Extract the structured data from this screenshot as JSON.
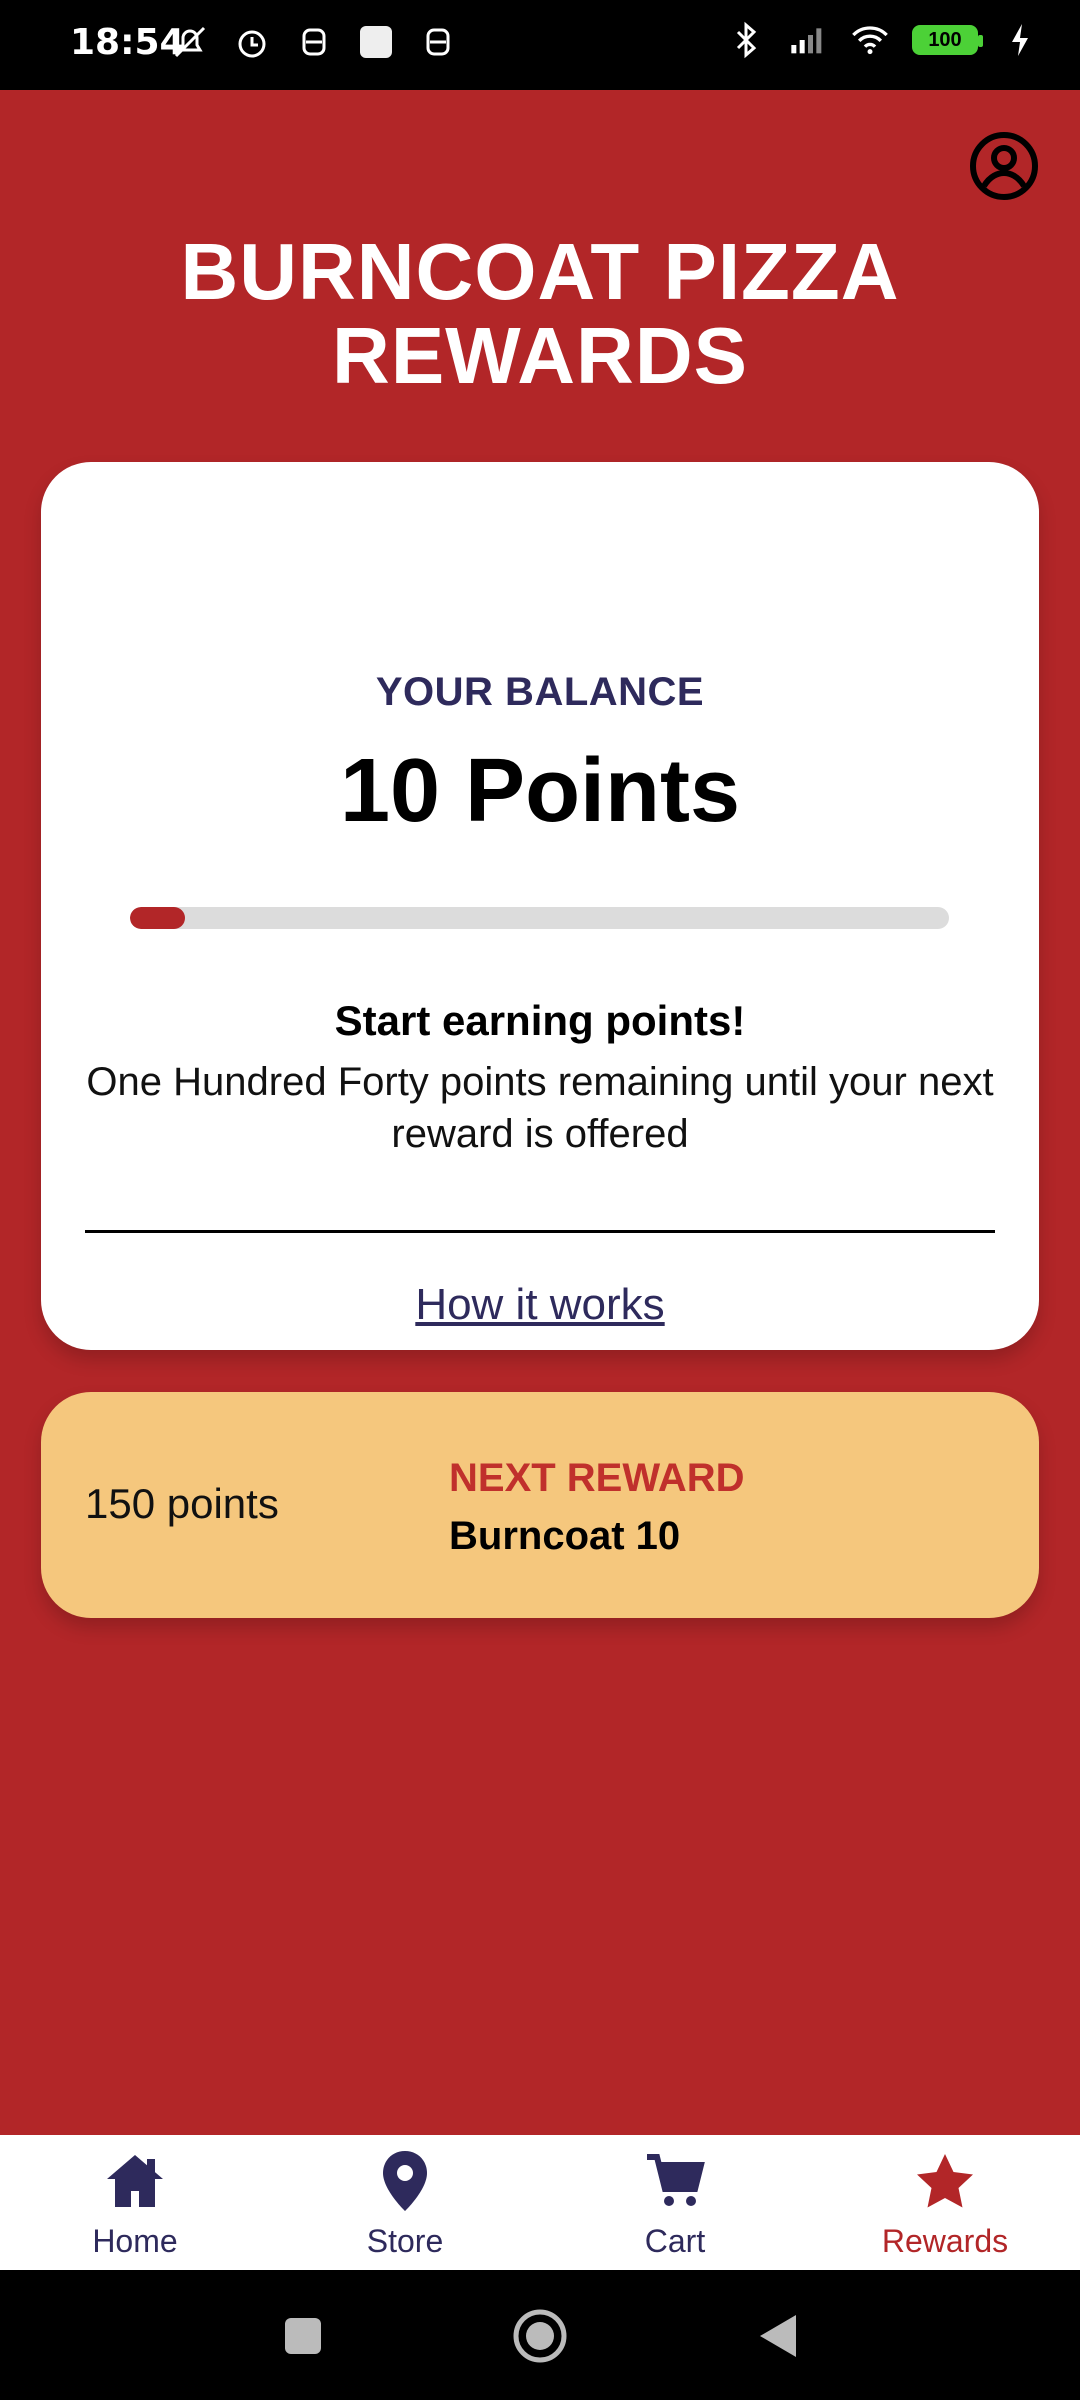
{
  "status": {
    "time": "18:54",
    "battery": "100",
    "icons_left": [
      "mute-icon",
      "alarm-icon",
      "app-icon",
      "square-icon",
      "app-icon-2"
    ],
    "icons_right": [
      "bluetooth-icon",
      "signal-icon",
      "wifi-icon",
      "battery-icon",
      "charging-icon"
    ]
  },
  "header": {
    "title_line1": "BURNCOAT PIZZA",
    "title_line2": "REWARDS"
  },
  "balance": {
    "label": "YOUR BALANCE",
    "points_text": "10 Points",
    "progress_fraction": 0.0667,
    "earn_title": "Start earning points!",
    "earn_desc": "One Hundred Forty points remaining until your next reward is offered",
    "how_link": "How it works"
  },
  "next_reward": {
    "points": "150 points",
    "label": "NEXT REWARD",
    "name": "Burncoat 10"
  },
  "nav": {
    "items": [
      {
        "label": "Home",
        "icon": "home-icon"
      },
      {
        "label": "Store",
        "icon": "location-pin-icon"
      },
      {
        "label": "Cart",
        "icon": "cart-icon"
      },
      {
        "label": "Rewards",
        "icon": "star-icon",
        "active": true
      }
    ]
  },
  "colors": {
    "brand_red": "#b22628",
    "navy": "#2e2a5c",
    "reward_bg": "#f5c77d"
  }
}
